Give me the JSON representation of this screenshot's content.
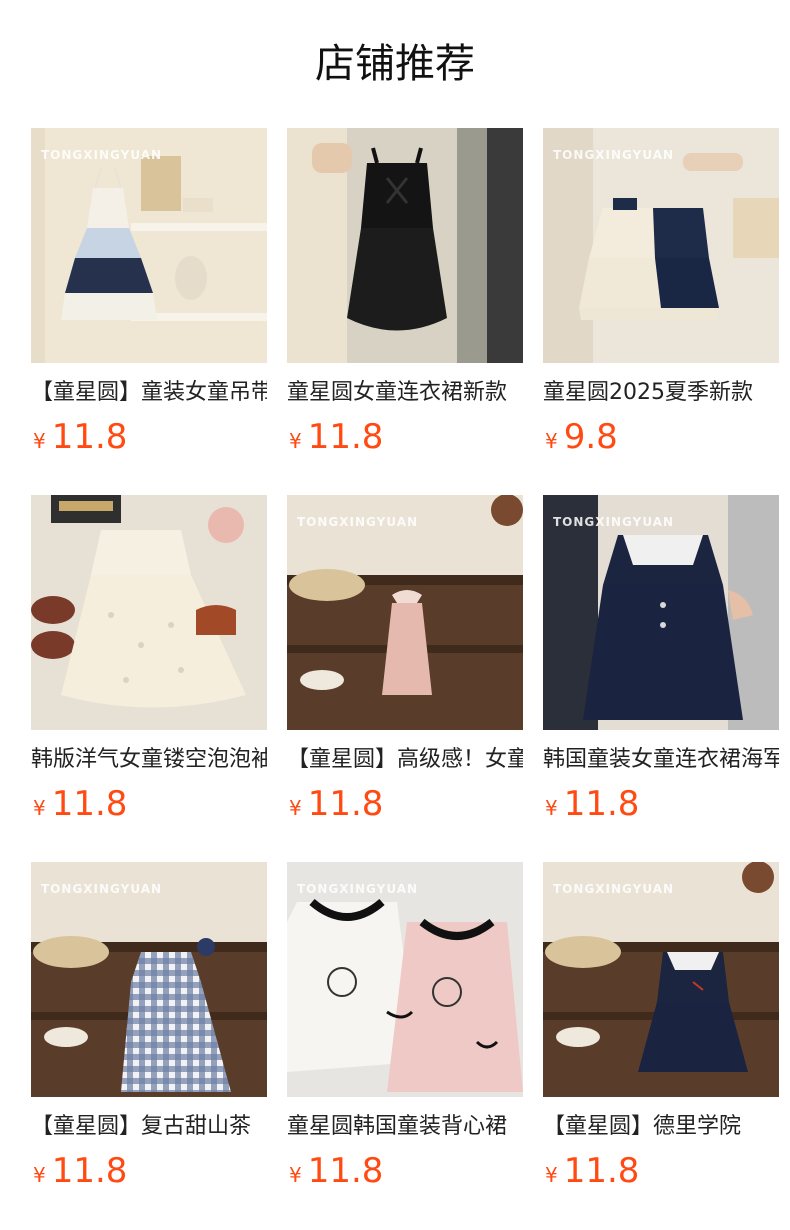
{
  "page": {
    "title": "店铺推荐"
  },
  "watermark": "TONGXINGYUAN",
  "colors": {
    "price": "#ff4a13",
    "title": "#111111",
    "name": "#222222"
  },
  "products": [
    {
      "name": "【童星圆】童装女童吊带裙",
      "currency": "¥",
      "price": "11.8",
      "image": "white-blue-tiered-sling-dress",
      "watermark": true
    },
    {
      "name": "童星圆女童连衣裙新款",
      "currency": "¥",
      "price": "11.8",
      "image": "black-bubble-dress",
      "watermark": false
    },
    {
      "name": "童星圆2025夏季新款",
      "currency": "¥",
      "price": "9.8",
      "image": "navy-cream-dress",
      "watermark": true
    },
    {
      "name": "韩版洋气女童镂空泡泡袖",
      "currency": "¥",
      "price": "11.8",
      "image": "white-eyelet-dress",
      "watermark": false
    },
    {
      "name": "【童星圆】高级感！女童",
      "currency": "¥",
      "price": "11.8",
      "image": "pink-collar-dress",
      "watermark": true
    },
    {
      "name": "韩国童装女童连衣裙海军",
      "currency": "¥",
      "price": "11.8",
      "image": "navy-sailor-dress",
      "watermark": true
    },
    {
      "name": "【童星圆】复古甜山茶",
      "currency": "¥",
      "price": "11.8",
      "image": "blue-gingham-dress",
      "watermark": true
    },
    {
      "name": "童星圆韩国童装背心裙",
      "currency": "¥",
      "price": "11.8",
      "image": "printed-tank-dresses",
      "watermark": true
    },
    {
      "name": "【童星圆】德里学院",
      "currency": "¥",
      "price": "11.8",
      "image": "navy-sailor-pleated-dress",
      "watermark": true
    }
  ]
}
